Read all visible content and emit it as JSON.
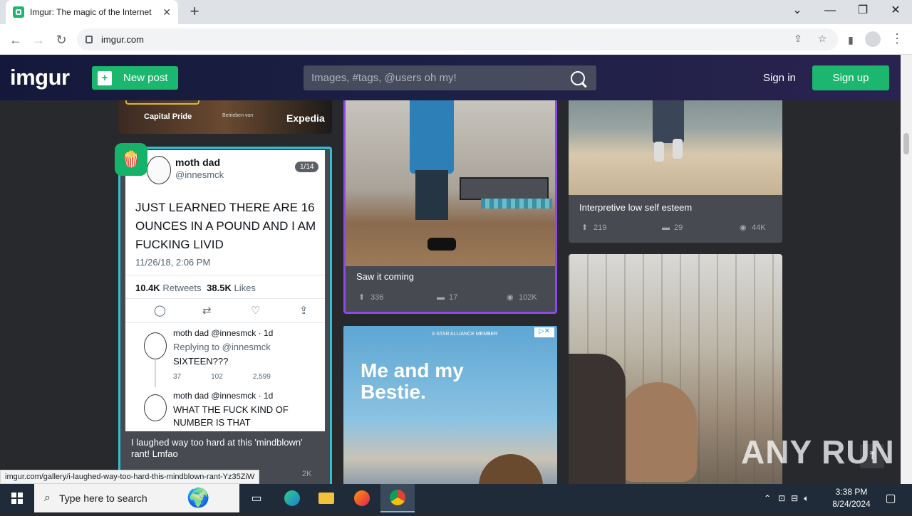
{
  "browser": {
    "tab_title": "Imgur: The magic of the Internet",
    "tab_close": "✕",
    "new_tab": "+",
    "url": "imgur.com",
    "status_url": "imgur.com/gallery/i-laughed-way-too-hard-this-mindblown-rant-Yz35ZiW"
  },
  "header": {
    "logo": "imgur",
    "new_post": "New post",
    "search_placeholder": "Images, #tags, @users oh my!",
    "sign_in": "Sign in",
    "sign_up": "Sign up"
  },
  "posts": {
    "left_top": {
      "badge1": "Capital Pride",
      "badge2": "Expedia",
      "badge3": "Betrieben von"
    },
    "tweet_post": {
      "counter": "1/14",
      "name": "moth dad",
      "handle": "@innesmck",
      "text": "JUST LEARNED THERE ARE 16 OUNCES IN A POUND AND I AM FUCKING LIVID",
      "date": "11/26/18, 2:06 PM",
      "retweets_num": "10.4K",
      "retweets_label": "Retweets",
      "likes_num": "38.5K",
      "likes_label": "Likes",
      "reply1_head": "moth dad @innesmck · 1d",
      "reply1_replying": "Replying to @innesmck",
      "reply1_text": "SIXTEEN???",
      "reply1_stats": [
        "37",
        "102",
        "2,599"
      ],
      "reply2_head": "moth dad @innesmck · 1d",
      "reply2_text": "WHAT THE FUCK KIND OF NUMBER IS THAT",
      "caption": "I laughed way too hard at this 'mindblown' rant! Lmfao",
      "views_partial": "2K"
    },
    "middle": {
      "caption": "Saw it coming",
      "upvotes": "336",
      "comments": "17",
      "views": "102K"
    },
    "right_top": {
      "caption": "Interpretive low self esteem",
      "upvotes": "219",
      "comments": "29",
      "views": "44K"
    },
    "ad": {
      "small": "A STAR ALLIANCE MEMBER",
      "headline_1": "Me and my",
      "headline_2": "Bestie."
    }
  },
  "taskbar": {
    "search_text": "Type here to search",
    "time": "3:38 PM",
    "date": "8/24/2024"
  },
  "watermark": "ANY RUN",
  "colors": {
    "accent": "#1bb76e",
    "header": "#1b1f43",
    "bg": "#27292d"
  }
}
